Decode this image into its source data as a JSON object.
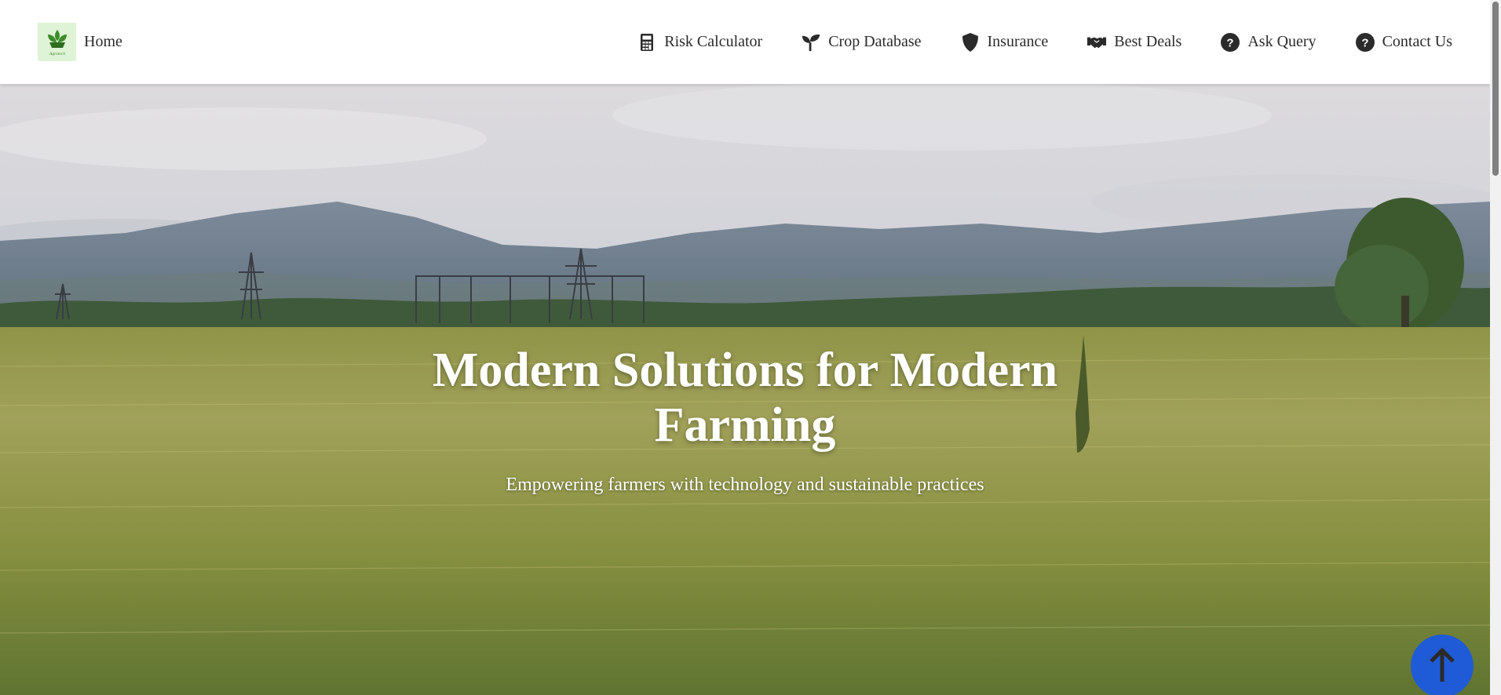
{
  "navbar": {
    "brand_label": "Home",
    "logo_caption": "Agrotech",
    "items": [
      {
        "label": "Risk Calculator",
        "icon": "calculator-icon"
      },
      {
        "label": "Crop Database",
        "icon": "seedling-icon"
      },
      {
        "label": "Insurance",
        "icon": "shield-icon"
      },
      {
        "label": "Best Deals",
        "icon": "handshake-icon"
      },
      {
        "label": "Ask Query",
        "icon": "question-circle-icon"
      },
      {
        "label": "Contact Us",
        "icon": "question-circle-icon"
      }
    ]
  },
  "hero": {
    "title": "Modern Solutions for Modern Farming",
    "subtitle": "Empowering farmers with technology and sustainable practices"
  },
  "scroll_top": {
    "icon": "arrow-up-icon"
  },
  "colors": {
    "nav_text": "#2b2b2b",
    "logo_bg": "#dff3d6",
    "scroll_button": "#1f5bd6",
    "hero_text": "#ffffff"
  }
}
